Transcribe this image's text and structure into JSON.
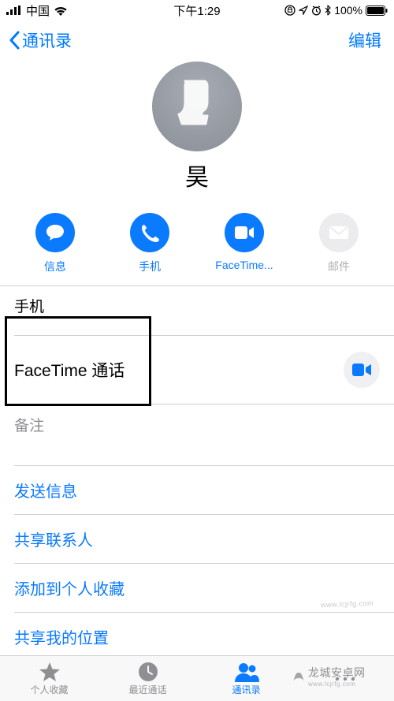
{
  "status": {
    "carrier": "中国",
    "time": "下午1:29",
    "battery": "100%"
  },
  "nav": {
    "back": "通讯录",
    "edit": "编辑"
  },
  "contact": {
    "name": "昊"
  },
  "actions": {
    "message": "信息",
    "phone": "手机",
    "facetime": "FaceTime...",
    "mail": "邮件"
  },
  "details": {
    "phone_label": "手机",
    "facetime_label": "FaceTime 通话",
    "notes_label": "备注"
  },
  "links": {
    "send_message": "发送信息",
    "share_contact": "共享联系人",
    "add_favorite": "添加到个人收藏",
    "share_location": "共享我的位置"
  },
  "tabs": {
    "favorites": "个人收藏",
    "recents": "最近通话",
    "contacts": "通讯录"
  },
  "watermark": {
    "brand": "龙城安卓网",
    "url": "www.lcjrfg.com"
  }
}
